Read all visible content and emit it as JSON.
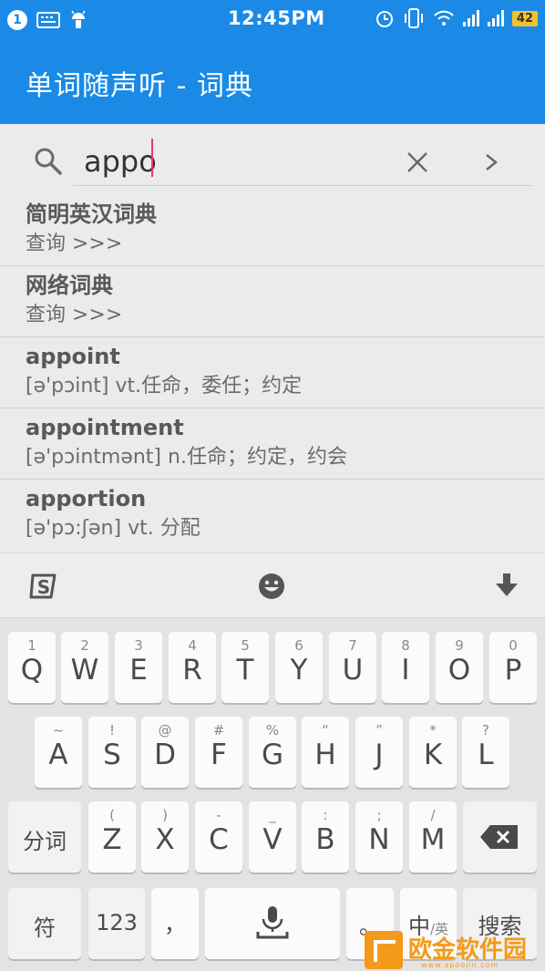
{
  "status_bar": {
    "notification_count": "1",
    "time": "12:45PM",
    "battery": "42",
    "icons": [
      "keyboard-icon",
      "android-icon",
      "alarm-icon",
      "vibrate-icon",
      "wifi-icon",
      "signal-icon",
      "signal-icon"
    ]
  },
  "app_bar": {
    "title": "单词随声听 - 词典"
  },
  "search": {
    "value": "appo",
    "icons": [
      "search-icon",
      "close-icon",
      "chevron-right-icon"
    ]
  },
  "results": [
    {
      "title": "简明英汉词典",
      "subtitle": "查询 >>>"
    },
    {
      "title": "网络词典",
      "subtitle": "查询 >>>"
    },
    {
      "title": "appoint",
      "subtitle": "[ə'pɔint] vt.任命，委任；约定"
    },
    {
      "title": "appointment",
      "subtitle": "[ə'pɔintmənt] n.任命；约定，约会"
    },
    {
      "title": "apportion",
      "subtitle": "[ə'pɔ:ʃən] vt. 分配"
    }
  ],
  "keyboard_toolbar": {
    "icons": [
      "sogou-logo-icon",
      "emoji-icon",
      "hide-keyboard-icon"
    ]
  },
  "keyboard": {
    "row1": [
      {
        "hint": "1",
        "label": "Q"
      },
      {
        "hint": "2",
        "label": "W"
      },
      {
        "hint": "3",
        "label": "E"
      },
      {
        "hint": "4",
        "label": "R"
      },
      {
        "hint": "5",
        "label": "T"
      },
      {
        "hint": "6",
        "label": "Y"
      },
      {
        "hint": "7",
        "label": "U"
      },
      {
        "hint": "8",
        "label": "I"
      },
      {
        "hint": "9",
        "label": "O"
      },
      {
        "hint": "0",
        "label": "P"
      }
    ],
    "row2": [
      {
        "hint": "~",
        "label": "A"
      },
      {
        "hint": "!",
        "label": "S"
      },
      {
        "hint": "@",
        "label": "D"
      },
      {
        "hint": "#",
        "label": "F"
      },
      {
        "hint": "%",
        "label": "G"
      },
      {
        "hint": "“",
        "label": "H"
      },
      {
        "hint": "”",
        "label": "J"
      },
      {
        "hint": "*",
        "label": "K"
      },
      {
        "hint": "?",
        "label": "L"
      }
    ],
    "row3": [
      {
        "hint": "(",
        "label": "Z"
      },
      {
        "hint": ")",
        "label": "X"
      },
      {
        "hint": "-",
        "label": "C"
      },
      {
        "hint": "_",
        "label": "V"
      },
      {
        "hint": ":",
        "label": "B"
      },
      {
        "hint": ";",
        "label": "N"
      },
      {
        "hint": "/",
        "label": "M"
      }
    ],
    "segment_label": "分词",
    "symbol_label": "符",
    "number_label": "123",
    "comma_label": "，",
    "period_label": "。",
    "lang_main": "中",
    "lang_sub": "/英",
    "search_label": "搜索"
  },
  "watermark": {
    "text": "欧金软件园",
    "url": "www.apoojin.com"
  },
  "colors": {
    "primary": "#1a8ae6",
    "cursor": "#e6396c",
    "battery": "#f3c12b",
    "watermark": "#f39a1a"
  }
}
